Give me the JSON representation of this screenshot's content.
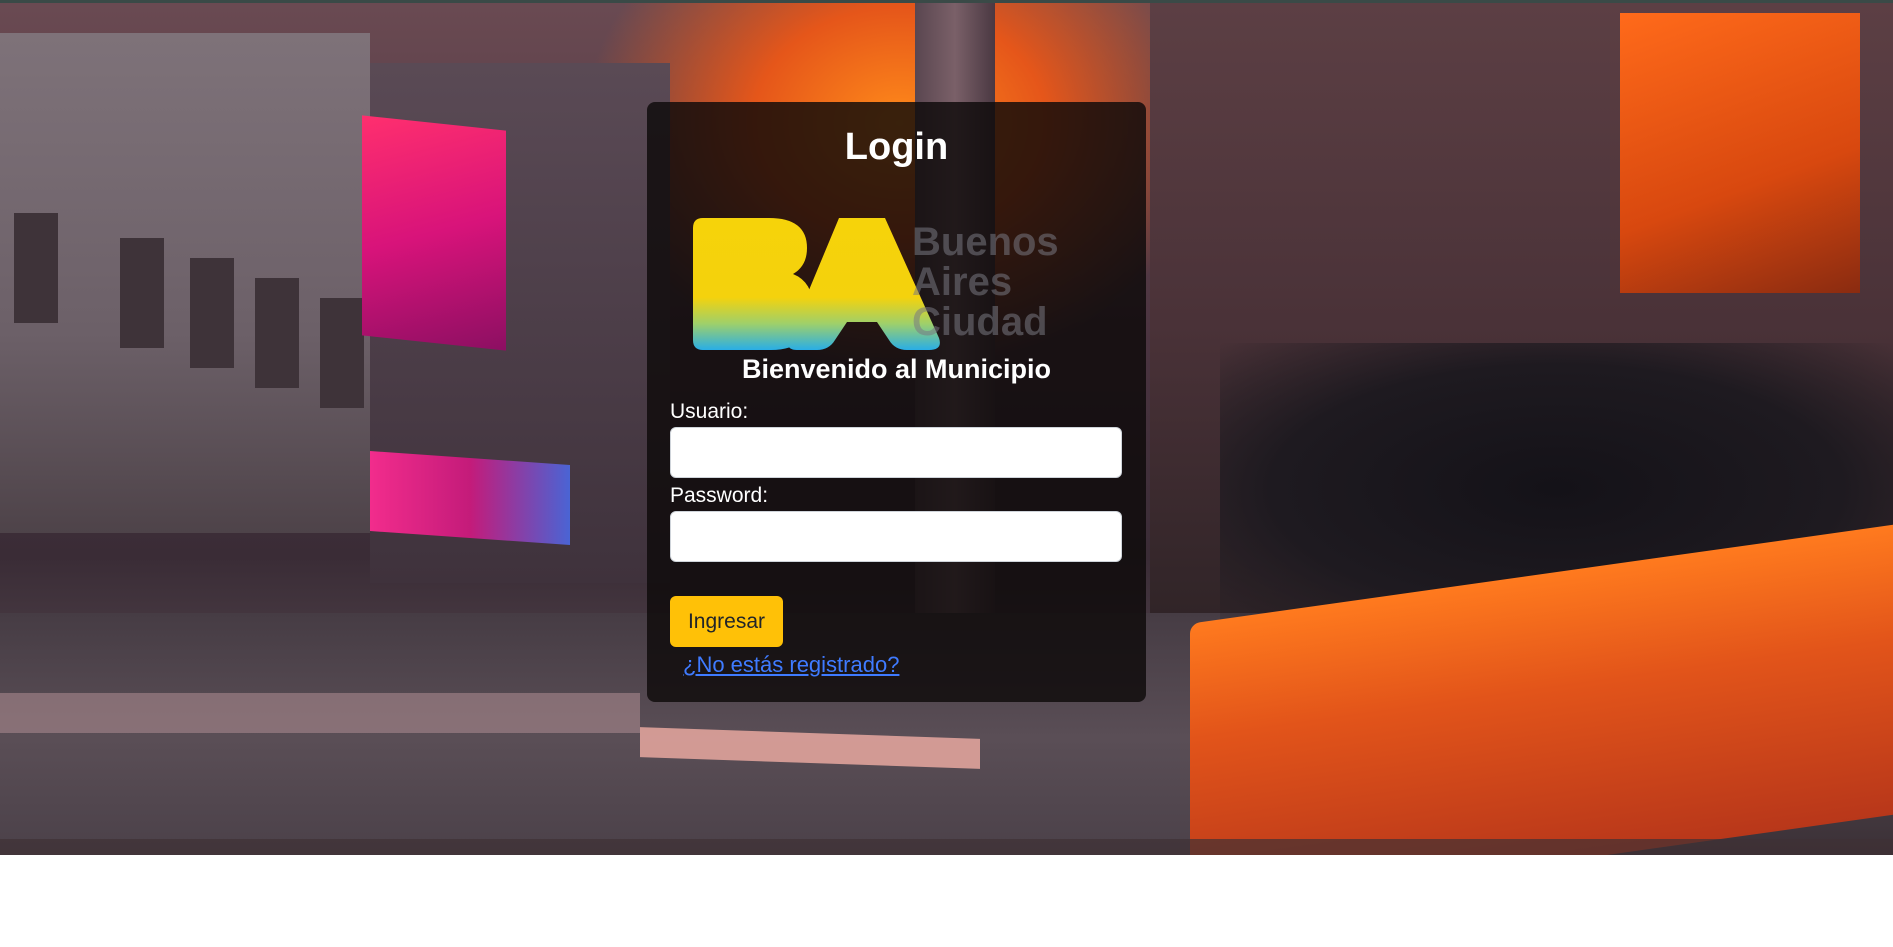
{
  "login": {
    "title": "Login",
    "logo_text": [
      "Buenos",
      "Aires",
      "Ciudad"
    ],
    "welcome": "Bienvenido al Municipio",
    "username_label": "Usuario:",
    "username_value": "",
    "password_label": "Password:",
    "password_value": "",
    "submit_label": "Ingresar",
    "register_link": "¿No estás registrado?"
  },
  "colors": {
    "accent": "#ffc107",
    "link": "#3f7bff",
    "logo_yellow": "#f6d30a",
    "logo_blue": "#29aee6"
  }
}
